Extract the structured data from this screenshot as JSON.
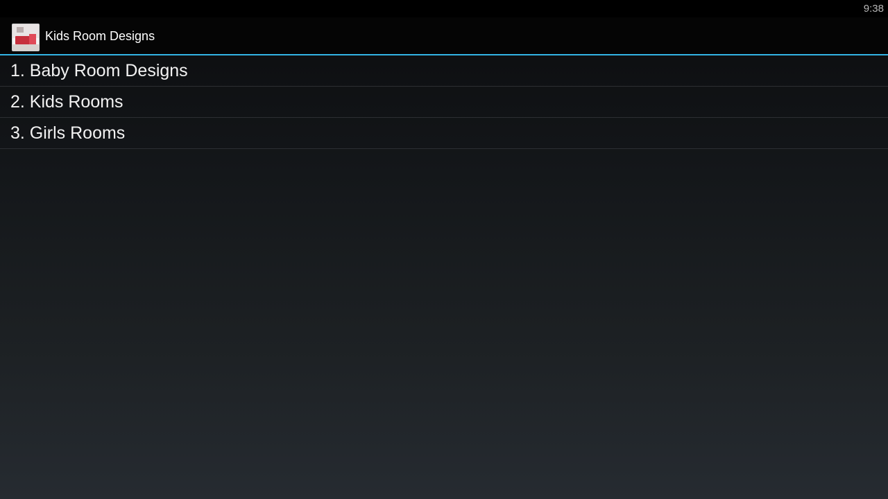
{
  "status_bar": {
    "time": "9:38"
  },
  "action_bar": {
    "title": "Kids Room Designs",
    "icon": "room-thumbnail-icon",
    "accent_color": "#33b5e5"
  },
  "menu": {
    "items": [
      {
        "label": "1. Baby Room Designs"
      },
      {
        "label": "2. Kids Rooms"
      },
      {
        "label": "3. Girls Rooms"
      }
    ]
  }
}
